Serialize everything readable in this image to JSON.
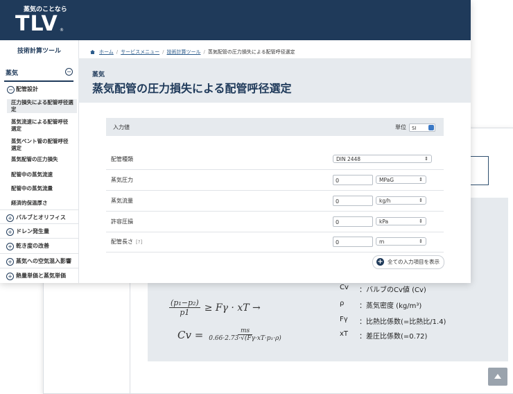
{
  "header": {
    "tagline": "蒸気のことなら",
    "logo": "TLV",
    "logo_mark": "®"
  },
  "sidebar": {
    "title": "技術計算ツール",
    "section": {
      "label": "蒸気",
      "toggle": "−"
    },
    "group": {
      "label": "配管設計",
      "toggle": "−"
    },
    "subitems": [
      "圧力損失による配管呼径選定",
      "蒸気流速による配管呼径選定",
      "蒸気ベント管の配管呼径選定",
      "蒸気配管の圧力損失",
      "配管中の蒸気流速",
      "配管中の蒸気流量",
      "経済的保温厚さ"
    ],
    "categories": [
      "バルブとオリフィス",
      "ドレン発生量",
      "乾き度の改善",
      "蒸気への空気混入影響",
      "熱量単価と蒸気単価"
    ],
    "category_toggle": "+"
  },
  "breadcrumb": {
    "home": "ホーム",
    "services": "サービスメニュー",
    "tools": "技術計算ツール",
    "current": "蒸気配管の圧力損失による配管呼径選定",
    "sep": "/"
  },
  "page": {
    "category": "蒸気",
    "title": "蒸気配管の圧力損失による配管呼径選定"
  },
  "input_section": {
    "label": "入力値",
    "unit_label": "単位",
    "unit_value": "SI"
  },
  "fields": [
    {
      "label": "配管種類",
      "value": "DIN 2448"
    },
    {
      "label": "蒸気圧力",
      "value": "0",
      "unit": "MPaG"
    },
    {
      "label": "蒸気流量",
      "value": "0",
      "unit": "kg/h"
    },
    {
      "label": "許容圧損",
      "value": "0",
      "unit": "kPa"
    },
    {
      "label": "配管長さ",
      "help": "[?]",
      "value": "0",
      "unit": "m"
    }
  ],
  "show_all_button": {
    "label": "全ての入力項目を表示",
    "icon": "+"
  },
  "formula": {
    "eq1": {
      "num": "(p₁−p₂)",
      "den": "p1",
      "rhs": "≥ Fγ · xT →"
    },
    "eq2": {
      "lhs": "Cv =",
      "num": "ms",
      "den": "0.66·2.73·√(Fγ·xT·p₁·ρ)"
    },
    "symbols": [
      {
        "sym": "Cv",
        "desc": "：バルブのCv値 (Cv)"
      },
      {
        "sym": "ρ",
        "desc": "：蒸気密度 (kg/m³)"
      },
      {
        "sym": "Fγ",
        "desc": "：比熱比係数(=比熱比/1.4)"
      },
      {
        "sym": "xT",
        "desc": "：差圧比係数(=0.72)"
      }
    ]
  },
  "colors": {
    "brand": "#1f3a5a",
    "panel": "#e6eaee",
    "accent": "#3a78c5"
  }
}
